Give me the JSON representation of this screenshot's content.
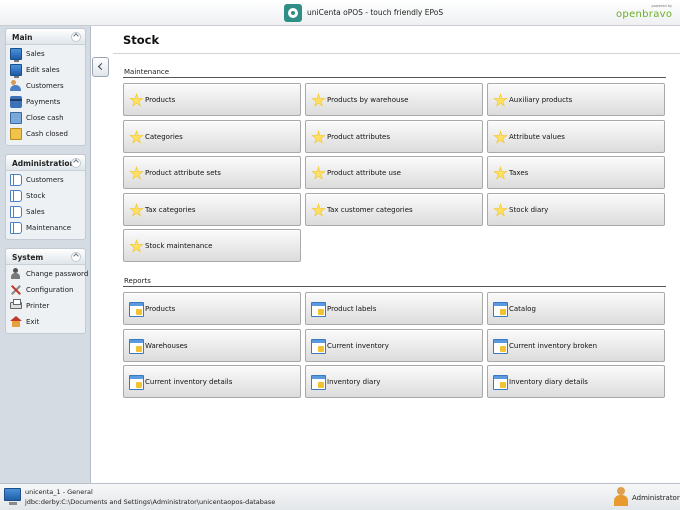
{
  "window": {
    "title": "uniCenta oPOS - touch friendly EPoS",
    "brand_small": "powered by",
    "brand": "openbravo"
  },
  "sidebar": {
    "main": {
      "title": "Main",
      "items": [
        {
          "label": "Sales",
          "icon": "monitor-icon"
        },
        {
          "label": "Edit sales",
          "icon": "monitor-icon"
        },
        {
          "label": "Customers",
          "icon": "users-icon"
        },
        {
          "label": "Payments",
          "icon": "card-icon"
        },
        {
          "label": "Close cash",
          "icon": "close-cash-icon"
        },
        {
          "label": "Cash closed",
          "icon": "folder-icon"
        }
      ]
    },
    "administration": {
      "title": "Administration",
      "items": [
        {
          "label": "Customers",
          "icon": "book-icon"
        },
        {
          "label": "Stock",
          "icon": "book-icon"
        },
        {
          "label": "Sales",
          "icon": "book-icon"
        },
        {
          "label": "Maintenance",
          "icon": "book-icon"
        }
      ]
    },
    "system": {
      "title": "System",
      "items": [
        {
          "label": "Change password",
          "icon": "people-icon"
        },
        {
          "label": "Configuration",
          "icon": "tools-icon"
        },
        {
          "label": "Printer",
          "icon": "printer-icon"
        },
        {
          "label": "Exit",
          "icon": "home-icon"
        }
      ]
    }
  },
  "page": {
    "title": "Stock",
    "maintenance": {
      "label": "Maintenance",
      "buttons": [
        "Products",
        "Products by warehouse",
        "Auxiliary products",
        "Categories",
        "Product attributes",
        "Attribute values",
        "Product attribute sets",
        "Product attribute use",
        "Taxes",
        "Tax categories",
        "Tax customer categories",
        "Stock diary",
        "Stock maintenance"
      ]
    },
    "reports": {
      "label": "Reports",
      "buttons": [
        "Products",
        "Product labels",
        "Catalog",
        "Warehouses",
        "Current inventory",
        "Current inventory broken",
        "Current inventory details",
        "Inventory diary",
        "Inventory diary details"
      ]
    }
  },
  "status": {
    "line1": "unicenta_1 - General",
    "line2": "jdbc:derby:C:\\Documents and Settings\\Administrator\\unicentaopos-database",
    "user": "Administrator"
  },
  "colors": {
    "sidebar_bg": "#d4dbe2",
    "star": "#f5c518",
    "brand_green": "#6ab023"
  }
}
